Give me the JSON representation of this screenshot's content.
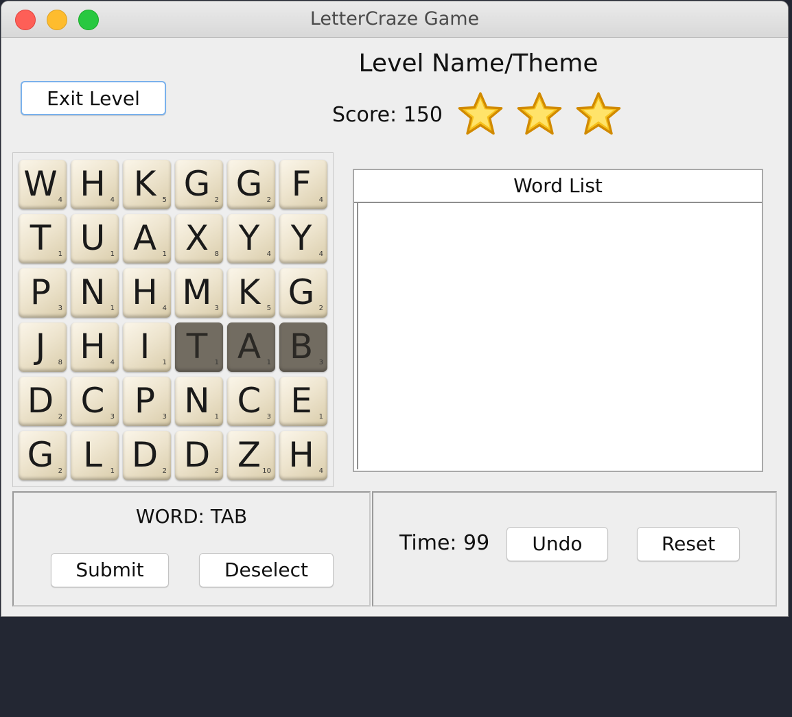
{
  "window": {
    "title": "LetterCraze Game"
  },
  "level": {
    "title": "Level Name/Theme",
    "exit_label": "Exit Level",
    "score_text": "Score: 150",
    "stars_earned": 3,
    "stars_total": 3,
    "star_color": "#f5b800"
  },
  "board": {
    "rows": [
      [
        {
          "letter": "W",
          "points": "4"
        },
        {
          "letter": "H",
          "points": "4"
        },
        {
          "letter": "K",
          "points": "5"
        },
        {
          "letter": "G",
          "points": "2"
        },
        {
          "letter": "G",
          "points": "2"
        },
        {
          "letter": "F",
          "points": "4"
        }
      ],
      [
        {
          "letter": "T",
          "points": "1"
        },
        {
          "letter": "U",
          "points": "1"
        },
        {
          "letter": "A",
          "points": "1"
        },
        {
          "letter": "X",
          "points": "8"
        },
        {
          "letter": "Y",
          "points": "4"
        },
        {
          "letter": "Y",
          "points": "4"
        }
      ],
      [
        {
          "letter": "P",
          "points": "3"
        },
        {
          "letter": "N",
          "points": "1"
        },
        {
          "letter": "H",
          "points": "4"
        },
        {
          "letter": "M",
          "points": "3"
        },
        {
          "letter": "K",
          "points": "5"
        },
        {
          "letter": "G",
          "points": "2"
        }
      ],
      [
        {
          "letter": "J",
          "points": "8"
        },
        {
          "letter": "H",
          "points": "4"
        },
        {
          "letter": "I",
          "points": "1"
        },
        {
          "letter": "T",
          "points": "1",
          "selected": true
        },
        {
          "letter": "A",
          "points": "1",
          "selected": true
        },
        {
          "letter": "B",
          "points": "3",
          "selected": true
        }
      ],
      [
        {
          "letter": "D",
          "points": "2"
        },
        {
          "letter": "C",
          "points": "3"
        },
        {
          "letter": "P",
          "points": "3"
        },
        {
          "letter": "N",
          "points": "1"
        },
        {
          "letter": "C",
          "points": "3"
        },
        {
          "letter": "E",
          "points": "1"
        }
      ],
      [
        {
          "letter": "G",
          "points": "2"
        },
        {
          "letter": "L",
          "points": "1"
        },
        {
          "letter": "D",
          "points": "2"
        },
        {
          "letter": "D",
          "points": "2"
        },
        {
          "letter": "Z",
          "points": "10"
        },
        {
          "letter": "H",
          "points": "4"
        }
      ]
    ],
    "selected_color": "#726c61"
  },
  "word_list": {
    "header": "Word List",
    "items": []
  },
  "word_panel": {
    "word_text": "WORD: TAB",
    "submit_label": "Submit",
    "deselect_label": "Deselect"
  },
  "control_panel": {
    "time_text": "Time: 99",
    "undo_label": "Undo",
    "reset_label": "Reset"
  }
}
